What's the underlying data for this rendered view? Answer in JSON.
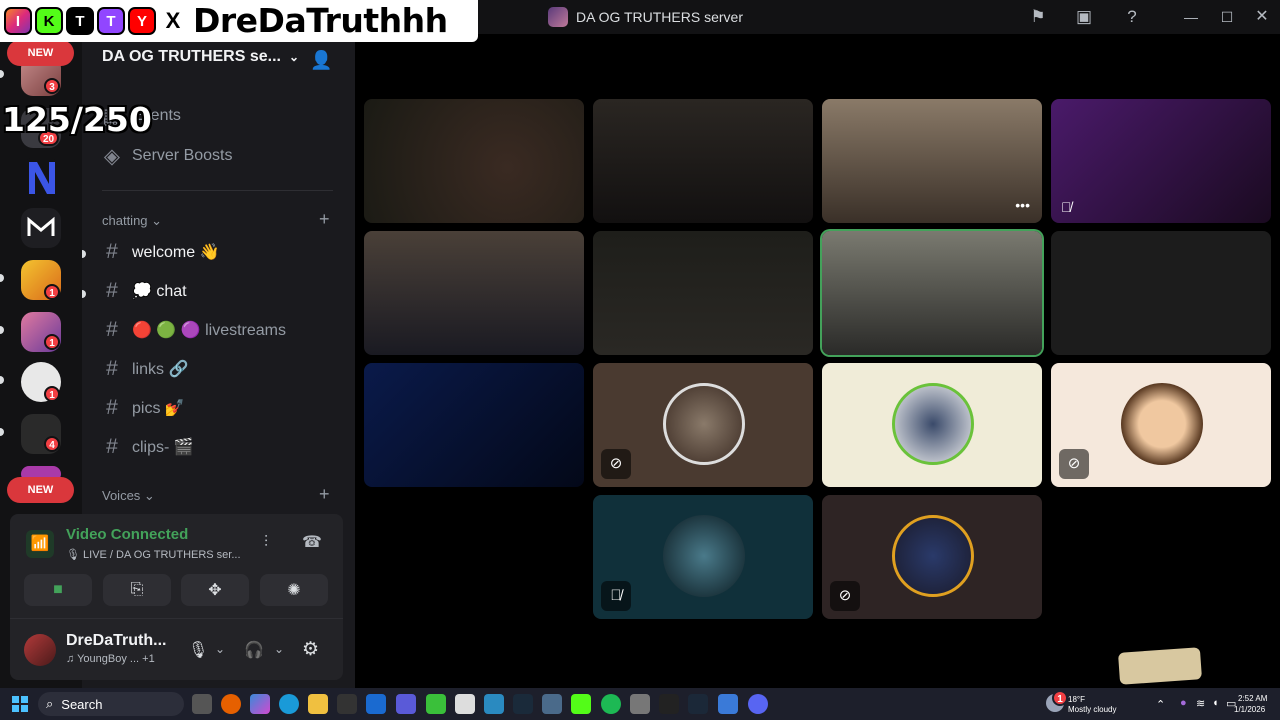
{
  "window": {
    "title": "DA OG TRUTHERS server"
  },
  "overlay": {
    "name": "DreDaTruthhh",
    "socials": [
      "I",
      "K",
      "T",
      "T",
      "Y",
      "X"
    ],
    "counter": "125/250"
  },
  "rail": {
    "new_badge": "NEW",
    "badges": [
      "3",
      "20",
      "1",
      "1",
      "1",
      "4"
    ]
  },
  "sidebar": {
    "server_name": "DA OG TRUTHERS se...",
    "events": "Events",
    "server_boosts": "Server Boosts",
    "category_chatting": "chatting",
    "category_voices": "Voices",
    "channels": [
      {
        "name": "welcome 👋"
      },
      {
        "name": "💭 chat"
      },
      {
        "name": "🔴 🟢 🟣 livestreams"
      },
      {
        "name": "links 🔗"
      },
      {
        "name": "pics 💅"
      },
      {
        "name": "clips- 🎬"
      }
    ]
  },
  "voice": {
    "status": "Video Connected",
    "channel": "🎙 LIVE / DA OG TRUTHERS ser...",
    "user_name": "DreDaTruth...",
    "user_activity": "♫ YoungBoy ...  +1"
  },
  "taskbar": {
    "search": "Search",
    "weather_temp": "18°F",
    "weather_desc": "Mostly cloudy",
    "weather_badge": "1",
    "time": "2:52 AM",
    "date": "1/1/2026"
  },
  "colors": {
    "accent_green": "#43a25a",
    "badge_red": "#f23f43"
  }
}
